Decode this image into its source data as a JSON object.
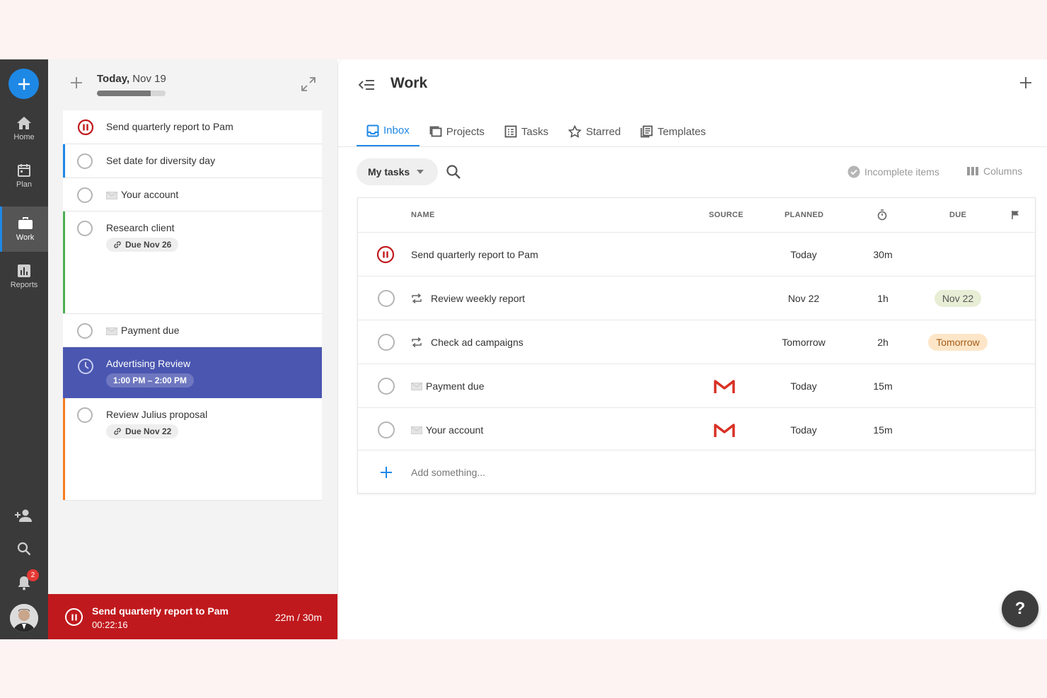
{
  "colors": {
    "accent": "#1e88e5",
    "rail": "#3a3a3a",
    "timer": "#c0191d",
    "event": "#4a56b0"
  },
  "nav": [
    {
      "label": "Home",
      "icon": "home-icon"
    },
    {
      "label": "Plan",
      "icon": "calendar-icon"
    },
    {
      "label": "Work",
      "icon": "briefcase-icon"
    },
    {
      "label": "Reports",
      "icon": "bar-chart-icon"
    }
  ],
  "notifications": {
    "count": "2"
  },
  "day": {
    "title_bold": "Today,",
    "title_rest": " Nov 19",
    "progress": 0.78
  },
  "cards": [
    {
      "title": "Send quarterly report to Pam"
    },
    {
      "title": "Set date for diversity day"
    },
    {
      "title": "Your account"
    },
    {
      "title": "Research client",
      "pill": "Due Nov 26"
    },
    {
      "title": "Payment due"
    },
    {
      "title": "Advertising Review",
      "pill": "1:00 PM – 2:00 PM"
    },
    {
      "title": "Review Julius proposal",
      "pill": "Due Nov 22"
    }
  ],
  "timer": {
    "title": "Send quarterly report to Pam",
    "elapsed": "00:22:16",
    "ratio": "22m / 30m"
  },
  "main": {
    "title": "Work",
    "tabs": [
      "Inbox",
      "Projects",
      "Tasks",
      "Starred",
      "Templates"
    ],
    "filter": "My tasks",
    "incomplete": "Incomplete items",
    "columns": "Columns",
    "headers": {
      "name": "NAME",
      "source": "SOURCE",
      "planned": "PLANNED",
      "due": "DUE"
    },
    "rows": [
      {
        "name": "Send quarterly report to Pam",
        "planned": "Today",
        "estimate": "30m",
        "due": ""
      },
      {
        "name": "Review weekly report",
        "planned": "Nov 22",
        "estimate": "1h",
        "due": "Nov 22"
      },
      {
        "name": "Check ad campaigns",
        "planned": "Tomorrow",
        "estimate": "2h",
        "due": "Tomorrow"
      },
      {
        "name": "Payment due",
        "planned": "Today",
        "estimate": "15m",
        "due": ""
      },
      {
        "name": "Your account",
        "planned": "Today",
        "estimate": "15m",
        "due": ""
      }
    ],
    "add_placeholder": "Add something..."
  },
  "help": "?"
}
